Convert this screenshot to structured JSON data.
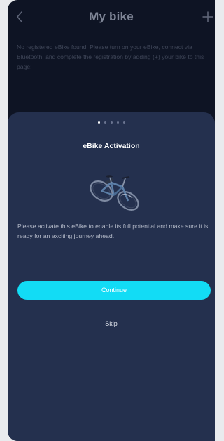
{
  "header": {
    "title": "My bike"
  },
  "empty_state": {
    "message": "No registered eBike found. Please turn on your eBike, connect via Bluetooth, and complete the registration by adding (+) your bike to this page!"
  },
  "activation_sheet": {
    "page_indicator": {
      "total": 5,
      "active_index": 0
    },
    "title": "eBike Activation",
    "description": "Please activate this eBike to enable its full potential and make sure it is ready for an exciting journey ahead.",
    "continue_label": "Continue",
    "skip_label": "Skip"
  },
  "colors": {
    "background": "#0e1424",
    "sheet": "#24304e",
    "accent": "#12dcf5"
  },
  "icons": {
    "back": "chevron-left-icon",
    "add": "plus-icon",
    "illustration": "bicycle-icon"
  }
}
